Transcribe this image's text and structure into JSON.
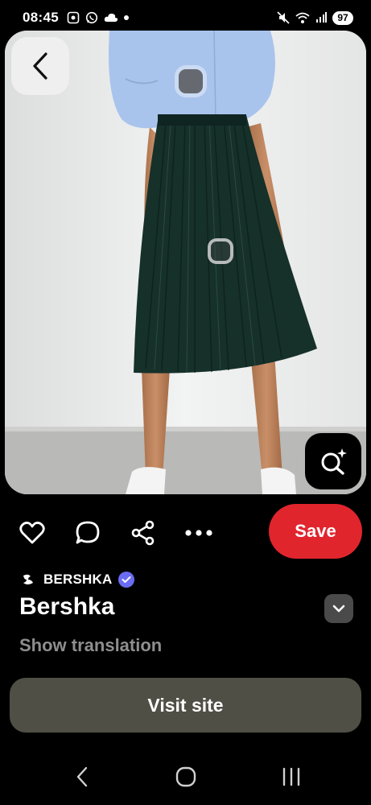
{
  "status_bar": {
    "time": "08:45",
    "battery": "97"
  },
  "pin": {
    "creator": "BERSHKA",
    "title": "Bershka",
    "show_translation": "Show translation",
    "save_label": "Save",
    "visit_site_label": "Visit site"
  },
  "colors": {
    "save": "#e1252d",
    "verified": "#6a6cf2",
    "visit_site_bg": "#4f4f45"
  },
  "icons": [
    "back-arrow-icon",
    "visual-search-icon",
    "heart-icon",
    "comment-icon",
    "share-icon",
    "more-icon",
    "chevron-down-icon",
    "verified-badge-icon",
    "nav-back-icon",
    "nav-home-icon",
    "nav-recents-icon"
  ]
}
